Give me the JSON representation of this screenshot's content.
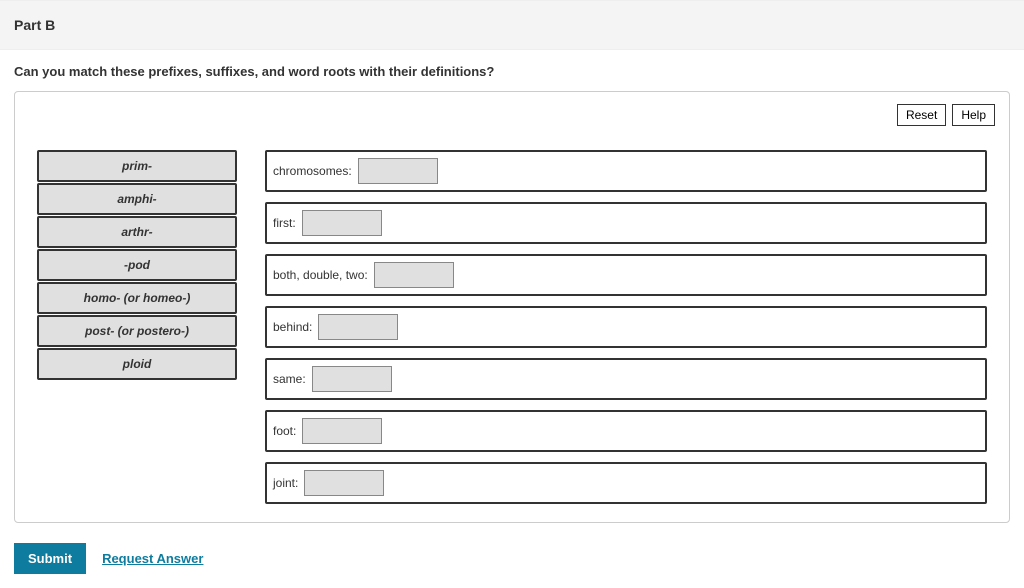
{
  "part_title": "Part B",
  "question": "Can you match these prefixes, suffixes, and word roots with their definitions?",
  "buttons": {
    "reset": "Reset",
    "help": "Help",
    "submit": "Submit",
    "request_answer": "Request Answer"
  },
  "sources": [
    "prim-",
    "amphi-",
    "arthr-",
    "-pod",
    "homo- (or homeo-)",
    "post- (or postero-)",
    "ploid"
  ],
  "targets": [
    {
      "label": "chromosomes:"
    },
    {
      "label": "first:"
    },
    {
      "label": "both, double, two:"
    },
    {
      "label": "behind:"
    },
    {
      "label": "same:"
    },
    {
      "label": "foot:"
    },
    {
      "label": "joint:"
    }
  ]
}
